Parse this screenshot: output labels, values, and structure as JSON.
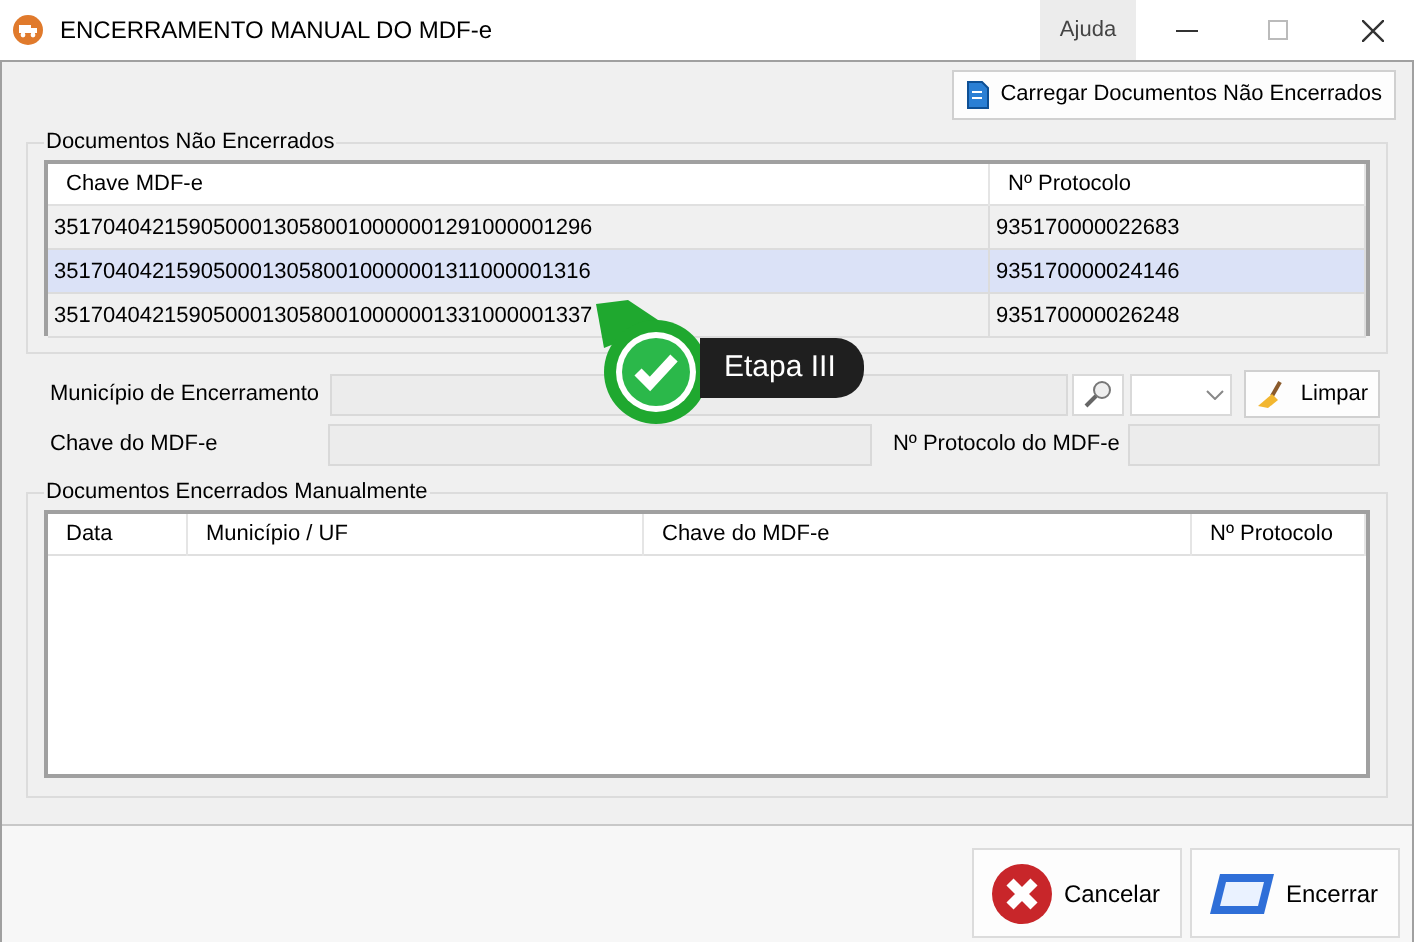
{
  "window": {
    "title": "ENCERRAMENTO MANUAL DO MDF-e",
    "help": "Ajuda"
  },
  "load_button": "Carregar Documentos Não Encerrados",
  "open_documents": {
    "title": "Documentos Não Encerrados",
    "columns": [
      "Chave MDF-e",
      "Nº Protocolo"
    ],
    "rows": [
      {
        "cells": [
          "35170404215905000130580010000001291000001296",
          "935170000022683"
        ],
        "selected": false
      },
      {
        "cells": [
          "35170404215905000130580010000001311000001316",
          "935170000024146"
        ],
        "selected": true
      },
      {
        "cells": [
          "35170404215905000130580010000001331000001337",
          "935170000026248"
        ],
        "selected": false
      }
    ]
  },
  "form": {
    "municipio_label": "Município de Encerramento",
    "chave_label": "Chave do MDF-e",
    "protocolo_label": "Nº Protocolo do MDF-e",
    "clear_button": "Limpar"
  },
  "closed_documents": {
    "title": "Documentos Encerrados Manualmente",
    "columns": [
      "Data",
      "Município / UF",
      "Chave do MDF-e",
      "Nº Protocolo"
    ]
  },
  "buttons": [
    {
      "kind": "cancel",
      "label": "Cancelar"
    },
    {
      "kind": "confirm",
      "label": "Encerrar"
    }
  ],
  "callout": {
    "label": "Etapa III"
  }
}
